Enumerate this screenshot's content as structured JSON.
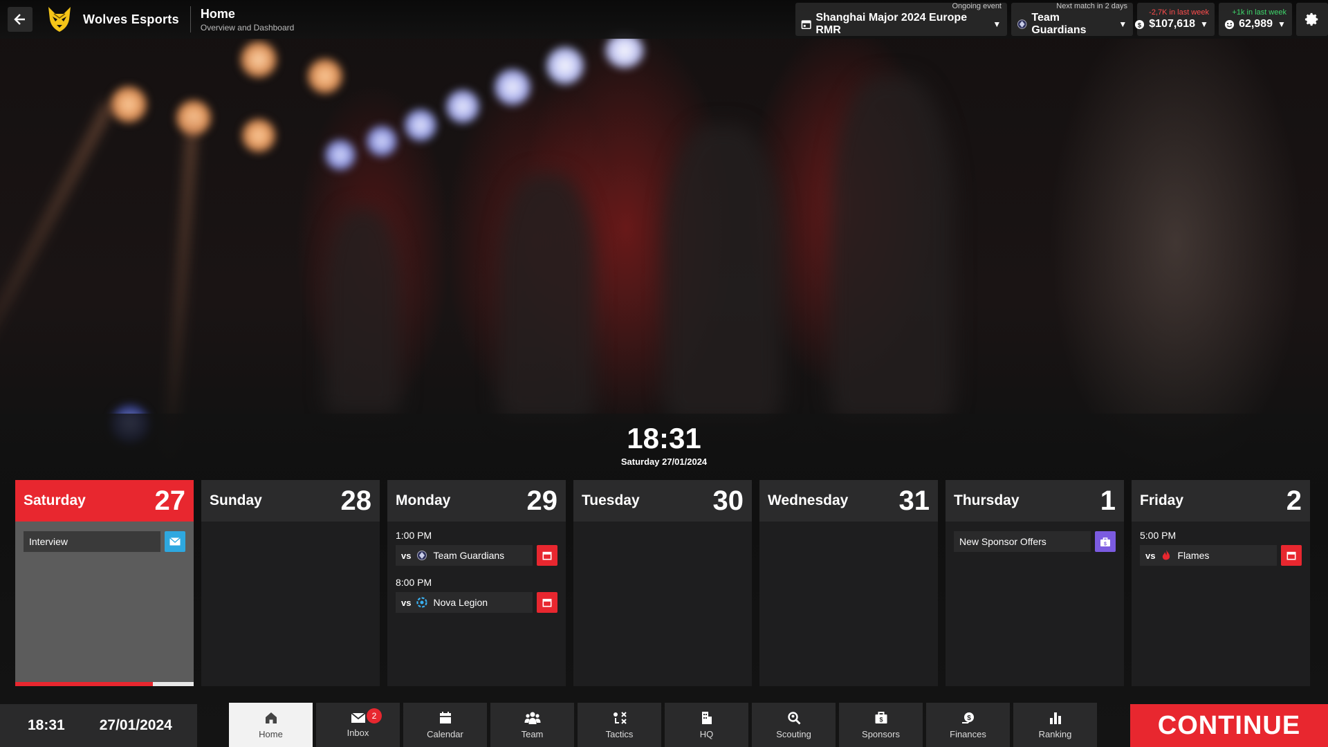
{
  "header": {
    "team_name": "Wolves Esports",
    "page_title": "Home",
    "page_subtitle": "Overview and Dashboard",
    "icons": {
      "back": "arrow-left-icon",
      "logo": "wolf-logo",
      "settings": "gear-icon"
    }
  },
  "status": {
    "event": {
      "caption": "Ongoing event",
      "value": "Shanghai Major 2024 Europe RMR",
      "icon": "calendar-icon"
    },
    "next_match": {
      "caption": "Next match in 2 days",
      "value": "Team Guardians",
      "icon": "team-logo-icon"
    },
    "money": {
      "caption": "-2,7K in last week",
      "value": "$107,618",
      "icon": "coin-icon",
      "caption_color": "#ff4d4d"
    },
    "fans": {
      "caption": "+1k in last week",
      "value": "62,989",
      "icon": "fans-icon",
      "caption_color": "#3fd66b"
    }
  },
  "clock": {
    "time": "18:31",
    "date": "Saturday 27/01/2024"
  },
  "days": [
    {
      "name": "Saturday",
      "num": "27",
      "active": true,
      "progress": 0.77,
      "events": [
        {
          "label": "Interview",
          "icon": "mail-icon",
          "color": "#2ea8e0"
        }
      ]
    },
    {
      "name": "Sunday",
      "num": "28"
    },
    {
      "name": "Monday",
      "num": "29",
      "matches": [
        {
          "time": "1:00 PM",
          "vs": "vs",
          "opponent": "Team Guardians",
          "icon": "calendar-icon"
        },
        {
          "time": "8:00 PM",
          "vs": "vs",
          "opponent": "Nova Legion",
          "icon": "calendar-icon"
        }
      ]
    },
    {
      "name": "Tuesday",
      "num": "30"
    },
    {
      "name": "Wednesday",
      "num": "31"
    },
    {
      "name": "Thursday",
      "num": "1",
      "events": [
        {
          "label": "New Sponsor Offers",
          "icon": "briefcase-icon",
          "color": "#7b5be0"
        }
      ]
    },
    {
      "name": "Friday",
      "num": "2",
      "matches": [
        {
          "time": "5:00 PM",
          "vs": "vs",
          "opponent": "Flames",
          "icon": "calendar-icon"
        }
      ]
    }
  ],
  "bottom": {
    "time": "18:31",
    "date": "27/01/2024"
  },
  "nav": [
    {
      "label": "Home",
      "icon": "home-icon",
      "active": true
    },
    {
      "label": "Inbox",
      "icon": "envelope-icon",
      "badge": "2"
    },
    {
      "label": "Calendar",
      "icon": "calendar-icon"
    },
    {
      "label": "Team",
      "icon": "team-icon"
    },
    {
      "label": "Tactics",
      "icon": "tactics-icon"
    },
    {
      "label": "HQ",
      "icon": "building-icon"
    },
    {
      "label": "Scouting",
      "icon": "magnifier-icon"
    },
    {
      "label": "Sponsors",
      "icon": "briefcase-icon"
    },
    {
      "label": "Finances",
      "icon": "money-icon"
    },
    {
      "label": "Ranking",
      "icon": "bar-chart-icon"
    }
  ],
  "continue_label": "CONTINUE",
  "colors": {
    "accent": "#e8272f",
    "panel": "#2a2a2b"
  }
}
